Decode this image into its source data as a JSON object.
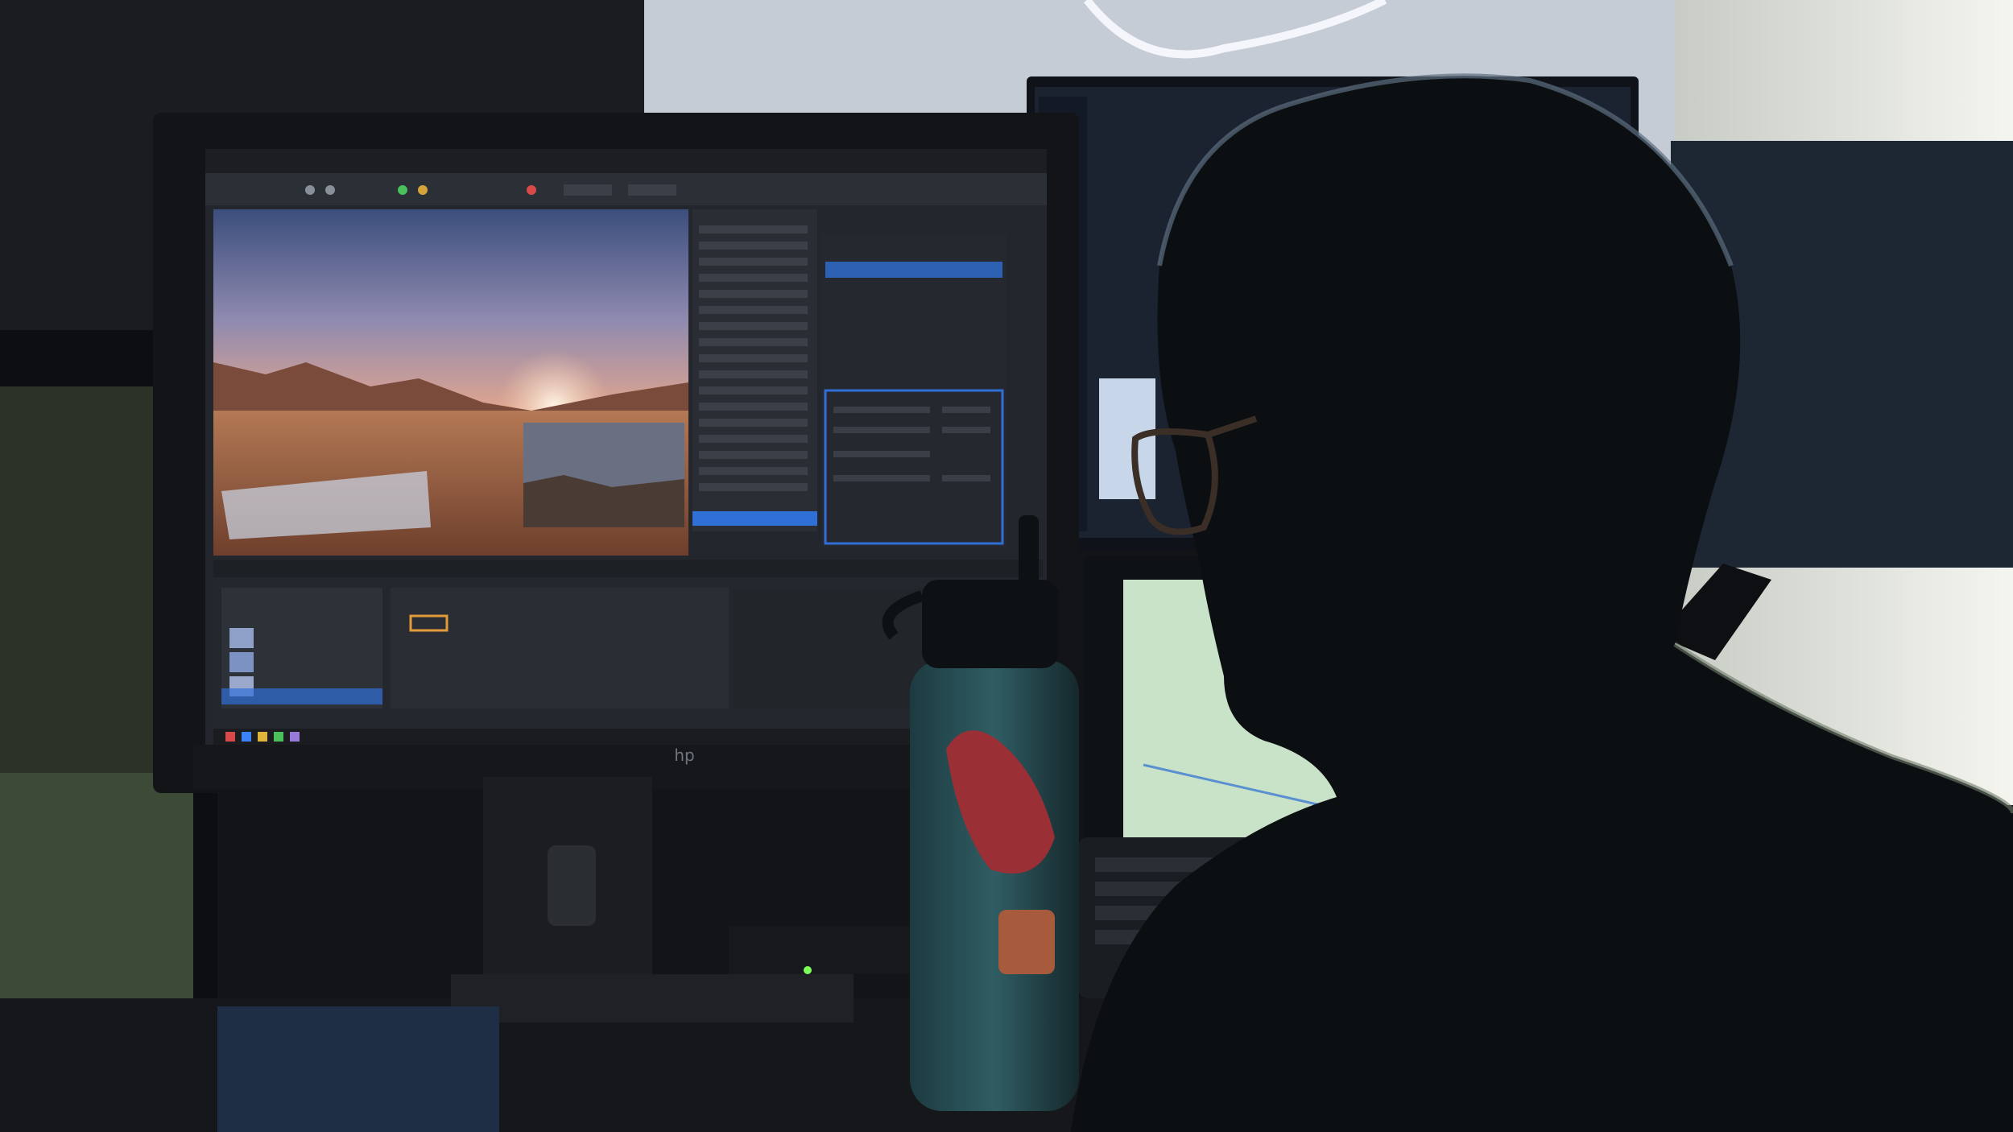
{
  "scene": {
    "description_tag": "photo",
    "monitor": {
      "brand_mark": "hp"
    }
  },
  "colors": {
    "editor_bg": "#23262c",
    "editor_panel": "#2b2f36",
    "editor_accent": "#2f6fd6",
    "sky_top": "#4b5f8c",
    "sky_bottom": "#d79b86",
    "desert": "#a86a48",
    "backlight": "#eef0ea"
  }
}
